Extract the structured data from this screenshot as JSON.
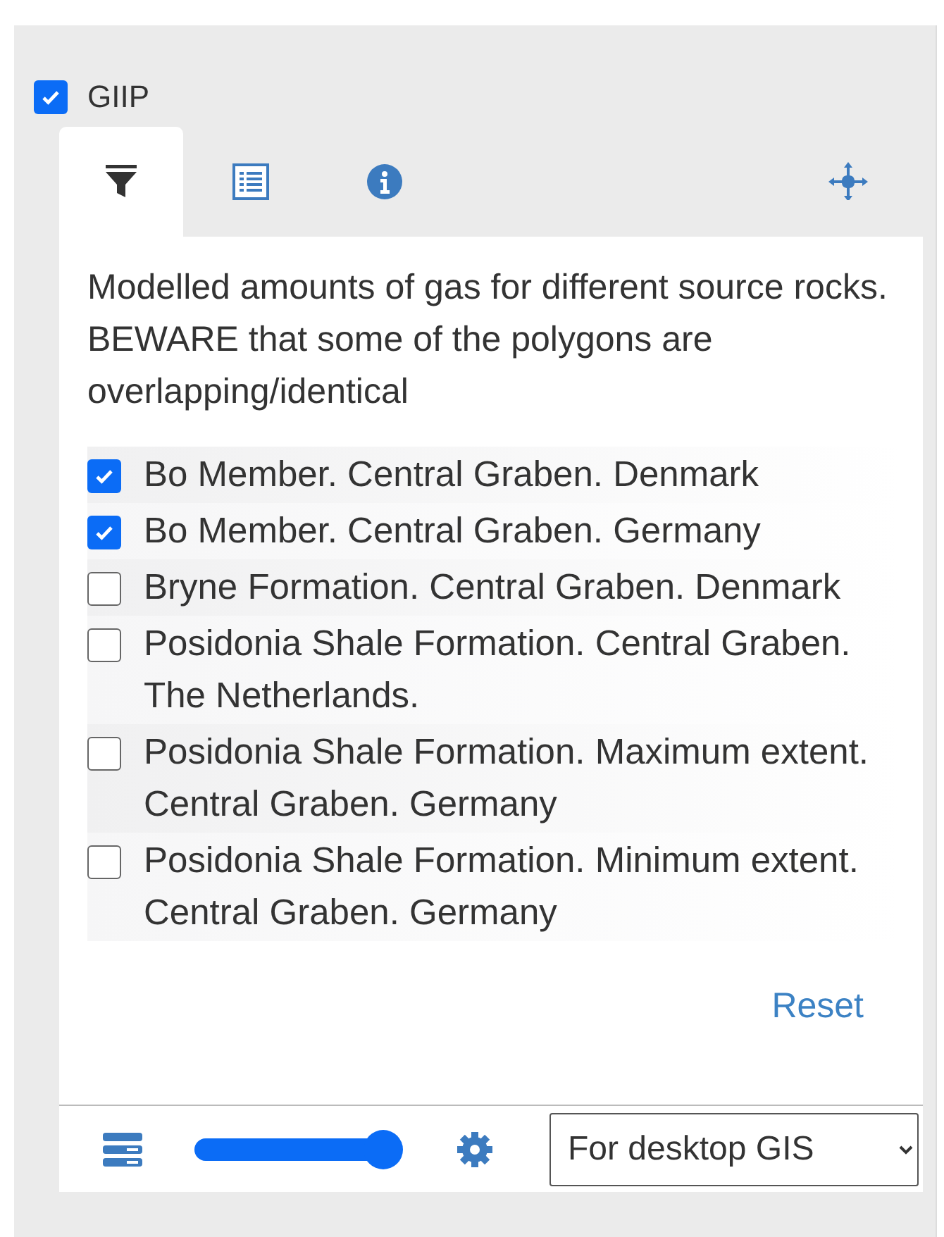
{
  "layer": {
    "label": "GIIP",
    "checked": true
  },
  "tabs": [
    {
      "kind": "filter",
      "selected": true
    },
    {
      "kind": "legend",
      "selected": false
    },
    {
      "kind": "info",
      "selected": false
    }
  ],
  "description": "Modelled amounts of gas for different source rocks. BEWARE that some of the polygons are overlapping/identical",
  "filters": [
    {
      "label": "Bo Member. Central Graben. Denmark",
      "checked": true
    },
    {
      "label": "Bo Member. Central Graben. Germany",
      "checked": true
    },
    {
      "label": "Bryne Formation. Central Graben. Denmark",
      "checked": false
    },
    {
      "label": "Posidonia Shale Formation. Central Graben. The Netherlands.",
      "checked": false
    },
    {
      "label": "Posidonia Shale Formation. Maximum extent. Central Graben. Germany",
      "checked": false
    },
    {
      "label": "Posidonia Shale Formation. Minimum extent. Central Graben. Germany",
      "checked": false
    }
  ],
  "reset": "Reset",
  "footer": {
    "opacity": {
      "level": 1
    },
    "download": "For desktop GIS"
  }
}
